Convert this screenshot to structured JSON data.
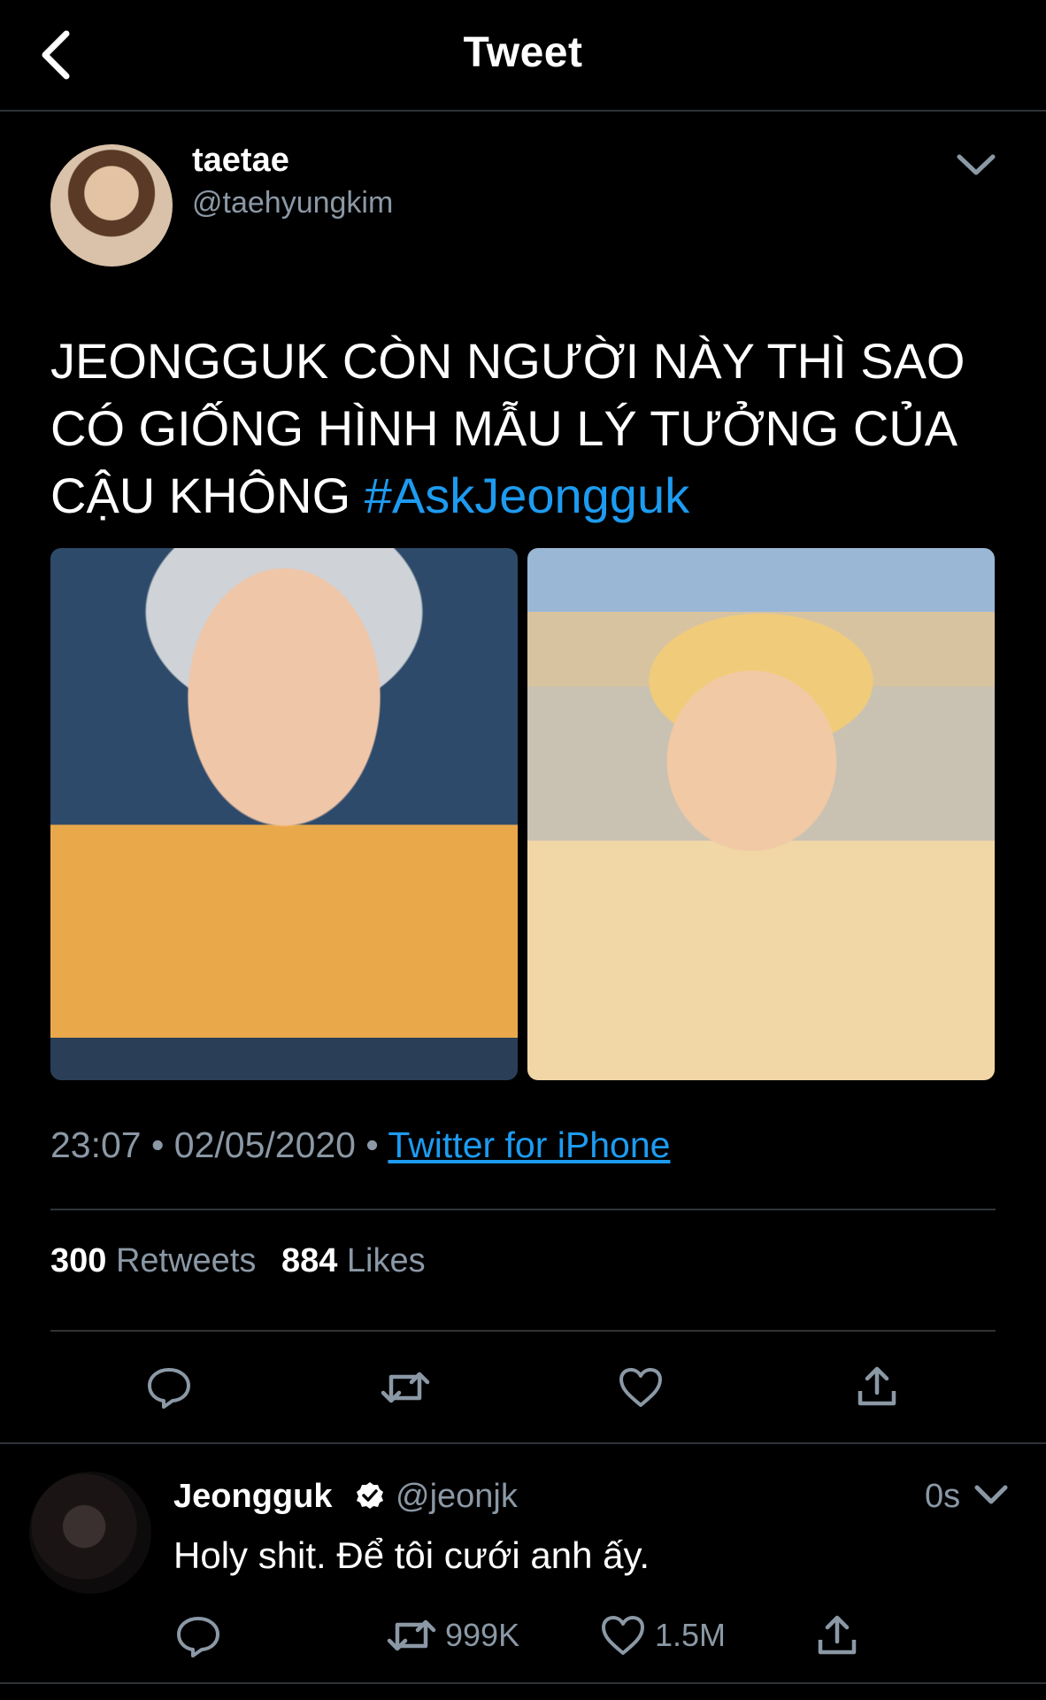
{
  "header": {
    "title": "Tweet"
  },
  "tweet": {
    "author": {
      "display_name": "taetae",
      "handle": "@taehyungkim"
    },
    "text": "JEONGGUK CÒN NGƯỜI NÀY THÌ SAO CÓ GIỐNG HÌNH MẪU LÝ TƯỞNG CỦA CẬU KHÔNG",
    "hashtag": "#AskJeongguk",
    "time": "23:07",
    "date": "02/05/2020",
    "separator": "•",
    "source": "Twitter for iPhone",
    "stats": {
      "retweets_count": "300",
      "retweets_label": "Retweets",
      "likes_count": "884",
      "likes_label": "Likes"
    },
    "media": [
      {
        "description": "photo-1"
      },
      {
        "description": "photo-2"
      }
    ]
  },
  "reply": {
    "author": {
      "display_name": "Jeongguk",
      "handle": "@jeonjk",
      "verified": true
    },
    "time": "0s",
    "text": "Holy shit. Để tôi cưới anh ấy.",
    "actions": {
      "retweets": "999K",
      "likes": "1.5M"
    }
  },
  "icons": {
    "back": "chevron-left-icon",
    "caret": "chevron-down-icon",
    "reply": "speech-bubble-icon",
    "retweet": "retweet-icon",
    "like": "heart-icon",
    "share": "share-icon",
    "verified": "verified-badge-icon"
  },
  "colors": {
    "accent": "#1d9bf0",
    "secondary_text": "#8b98a5",
    "background": "#000000",
    "divider": "#2f3336"
  }
}
